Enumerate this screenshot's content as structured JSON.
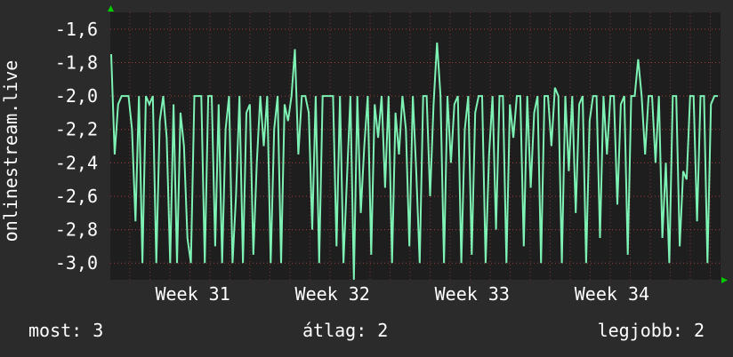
{
  "colors": {
    "background": "#2b2b2b",
    "plot_background": "#1e1e1e",
    "grid": "#a0403f",
    "line": "#7ef2b4",
    "axis_arrow": "#00cc00",
    "text": "#ffffff"
  },
  "chart_data": {
    "type": "line",
    "ylabel": "onlinestream.live",
    "ylim": [
      -3.1,
      -1.5
    ],
    "yticks": [
      -1.6,
      -1.8,
      -2.0,
      -2.2,
      -2.4,
      -2.6,
      -2.8,
      -3.0
    ],
    "ytick_labels": [
      "-1,6",
      "-1,8",
      "-2,0",
      "-2,2",
      "-2,4",
      "-2,6",
      "-2,8",
      "-3,0"
    ],
    "x_labels": [
      "Week 31",
      "Week 32",
      "Week 33",
      "Week 34"
    ],
    "grid": true,
    "series": [
      {
        "values": [
          -1.75,
          -2.35,
          -2.05,
          -2.0,
          -2.0,
          -2.0,
          -2.2,
          -2.75,
          -2.0,
          -3.0,
          -2.0,
          -2.05,
          -2.0,
          -3.0,
          -2.15,
          -2.0,
          -2.25,
          -3.0,
          -2.05,
          -3.0,
          -2.1,
          -2.3,
          -2.85,
          -3.0,
          -2.0,
          -2.0,
          -2.0,
          -3.0,
          -2.0,
          -2.0,
          -2.9,
          -2.05,
          -3.0,
          -2.2,
          -2.0,
          -3.0,
          -2.6,
          -2.0,
          -3.0,
          -2.1,
          -2.05,
          -2.95,
          -2.4,
          -2.0,
          -2.3,
          -2.0,
          -3.0,
          -2.2,
          -2.0,
          -3.0,
          -2.05,
          -2.15,
          -2.0,
          -1.72,
          -2.35,
          -2.0,
          -2.0,
          -2.1,
          -2.8,
          -2.0,
          -3.0,
          -2.0,
          -2.0,
          -2.0,
          -2.0,
          -2.9,
          -2.0,
          -3.0,
          -2.5,
          -2.0,
          -3.1,
          -2.0,
          -2.7,
          -2.3,
          -2.0,
          -2.95,
          -2.05,
          -2.25,
          -2.0,
          -2.55,
          -2.0,
          -3.0,
          -2.1,
          -2.35,
          -2.0,
          -2.2,
          -2.9,
          -2.0,
          -2.45,
          -3.0,
          -2.0,
          -2.0,
          -2.6,
          -2.05,
          -1.68,
          -2.0,
          -3.0,
          -2.0,
          -2.4,
          -2.05,
          -2.0,
          -3.0,
          -2.2,
          -2.0,
          -2.95,
          -2.1,
          -2.0,
          -2.0,
          -3.0,
          -2.35,
          -2.0,
          -2.8,
          -2.0,
          -2.0,
          -3.0,
          -2.05,
          -2.25,
          -2.0,
          -2.0,
          -2.9,
          -2.0,
          -2.55,
          -2.1,
          -2.0,
          -3.0,
          -2.0,
          -2.0,
          -2.3,
          -1.95,
          -2.0,
          -3.0,
          -2.0,
          -2.45,
          -2.0,
          -2.7,
          -2.05,
          -2.0,
          -3.0,
          -2.15,
          -2.0,
          -2.0,
          -2.85,
          -2.0,
          -2.35,
          -2.0,
          -2.0,
          -2.65,
          -2.05,
          -2.0,
          -2.95,
          -2.0,
          -2.0,
          -1.78,
          -2.0,
          -2.35,
          -2.0,
          -2.0,
          -2.4,
          -2.0,
          -2.85,
          -2.4,
          -3.0,
          -2.0,
          -2.0,
          -2.9,
          -2.45,
          -2.5,
          -2.0,
          -2.0,
          -2.75,
          -2.0,
          -2.0,
          -3.0,
          -2.05,
          -2.0,
          -2.0
        ]
      }
    ]
  },
  "stats": {
    "now": "most: 3",
    "average": "átlag: 2",
    "max": "legjobb: 2"
  }
}
